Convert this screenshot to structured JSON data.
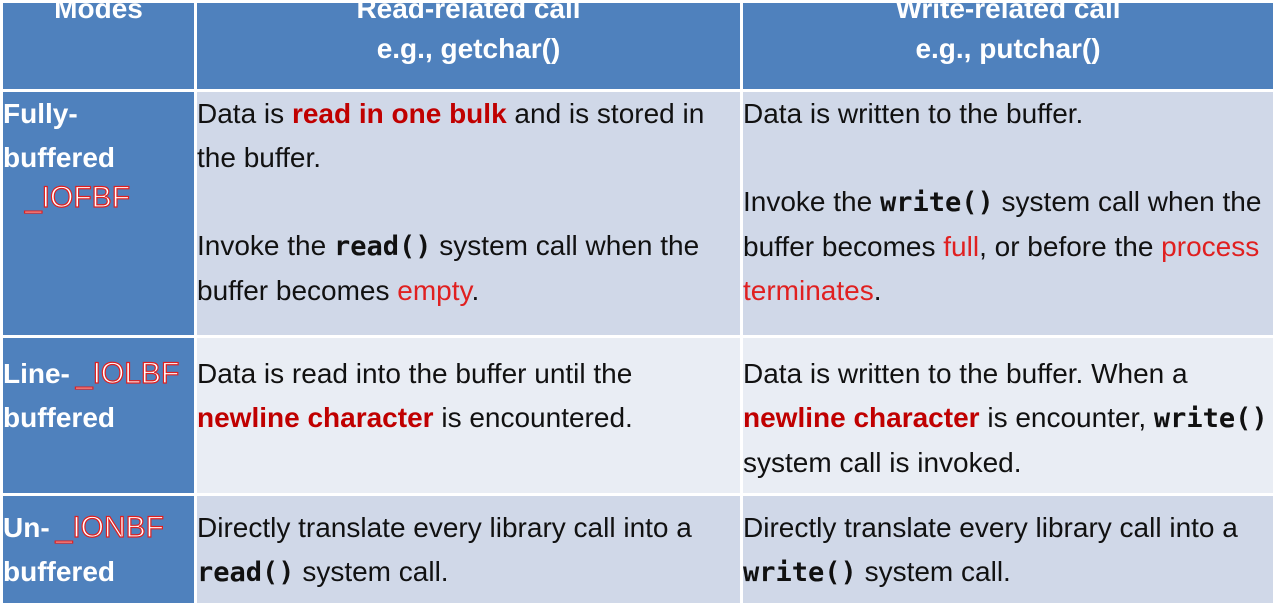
{
  "header": {
    "modes": "Modes",
    "read_line1": "Read-related call",
    "read_line2": "e.g., getchar()",
    "write_line1": "Write-related call",
    "write_line2": "e.g., putchar()"
  },
  "rows": [
    {
      "mode_line1": "Fully-",
      "mode_line2": "buffered",
      "flag": "_IOFBF",
      "read": {
        "p1_a": "Data is ",
        "p1_em": "read in one bulk",
        "p1_b": " and is stored in the buffer.",
        "p2_a": "Invoke the ",
        "p2_code": "read()",
        "p2_b": " system call when the buffer becomes ",
        "p2_red": "empty",
        "p2_c": "."
      },
      "write": {
        "p1": "Data is written to the buffer.",
        "p2_a": "Invoke the ",
        "p2_code": "write()",
        "p2_b": " system call when the buffer becomes ",
        "p2_red1": "full",
        "p2_c": ", or before the ",
        "p2_red2": "process terminates",
        "p2_d": "."
      }
    },
    {
      "mode_line1": "Line-",
      "mode_line2": "buffered",
      "flag": "_IOLBF",
      "read": {
        "a": "Data is read into the buffer until the ",
        "em": "newline character",
        "b": " is encountered."
      },
      "write": {
        "a": "Data is written to the buffer. When a ",
        "em": "newline character",
        "b": " is encounter, ",
        "code": "write()",
        "c": " system call is invoked."
      }
    },
    {
      "mode_line1": "Un-",
      "mode_line2": "buffered",
      "flag": "_IONBF",
      "read": {
        "a": "Directly translate every library call into a ",
        "code": "read()",
        "b": " system call."
      },
      "write": {
        "a": "Directly translate every library call into a ",
        "code": "write()",
        "b": " system call."
      }
    }
  ],
  "colors": {
    "header_bg": "#4f81bd",
    "row_dark": "#d0d8e8",
    "row_light": "#e9edf4",
    "emphasis": "#c00000",
    "highlight": "#e02020"
  }
}
